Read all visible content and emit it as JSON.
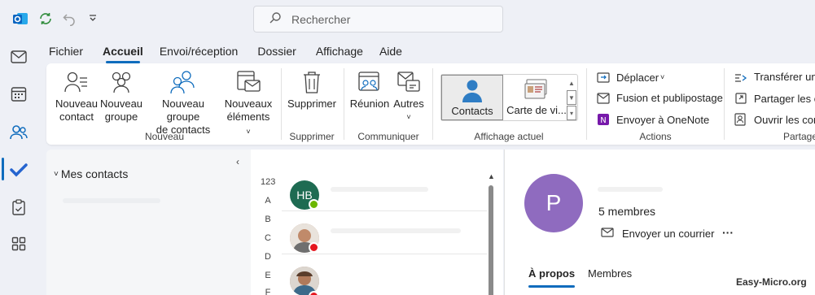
{
  "titlebar": {
    "search_placeholder": "Rechercher",
    "icons": [
      "outlook-icon",
      "sync-icon",
      "undo-icon",
      "customize-icon"
    ]
  },
  "menu": {
    "items": [
      {
        "label": "Fichier",
        "active": false
      },
      {
        "label": "Accueil",
        "active": true
      },
      {
        "label": "Envoi/réception",
        "active": false
      },
      {
        "label": "Dossier",
        "active": false
      },
      {
        "label": "Affichage",
        "active": false
      },
      {
        "label": "Aide",
        "active": false
      }
    ]
  },
  "ribbon": {
    "nouveau": {
      "group_label": "Nouveau",
      "new_contact": [
        "Nouveau",
        "contact"
      ],
      "new_group": [
        "Nouveau",
        "groupe"
      ],
      "new_contact_group": [
        "Nouveau groupe",
        "de contacts"
      ],
      "new_items": [
        "Nouveaux",
        "éléments"
      ]
    },
    "supprimer": {
      "group_label": "Supprimer",
      "delete": "Supprimer"
    },
    "communiquer": {
      "group_label": "Communiquer",
      "meeting": "Réunion",
      "others": "Autres"
    },
    "affichage": {
      "group_label": "Affichage actuel",
      "contacts": "Contacts",
      "business_card": "Carte de vi..."
    },
    "actions": {
      "group_label": "Actions",
      "move": "Déplacer",
      "merge": "Fusion et publipostage",
      "onenote": "Envoyer à OneNote"
    },
    "partager": {
      "group_label": "Partage",
      "forward": "Transférer un co",
      "share": "Partager les con",
      "open": "Ouvrir les conta"
    }
  },
  "folder_pane": {
    "my_contacts": "Mes contacts"
  },
  "contact_list": {
    "index_letters": [
      "123",
      "A",
      "B",
      "C",
      "D",
      "E",
      "F"
    ],
    "contacts": [
      {
        "initials": "HB",
        "avatar_color": "#1e6b52",
        "presence": "available"
      },
      {
        "initials": "",
        "avatar_color": "#b88a6e",
        "presence": "busy"
      },
      {
        "initials": "",
        "avatar_color": "#a37e64",
        "presence": "busy"
      }
    ]
  },
  "reading": {
    "avatar_letter": "P",
    "avatar_color": "#8f6bbf",
    "members_count": "5 membres",
    "send_mail": "Envoyer un courrier",
    "more": "···",
    "tabs": [
      {
        "label": "À propos",
        "active": true
      },
      {
        "label": "Membres",
        "active": false
      }
    ]
  },
  "watermark": "Easy-Micro.org",
  "colors": {
    "accent": "#0f6cbd",
    "available": "#6bb700",
    "busy": "#e5171f"
  }
}
